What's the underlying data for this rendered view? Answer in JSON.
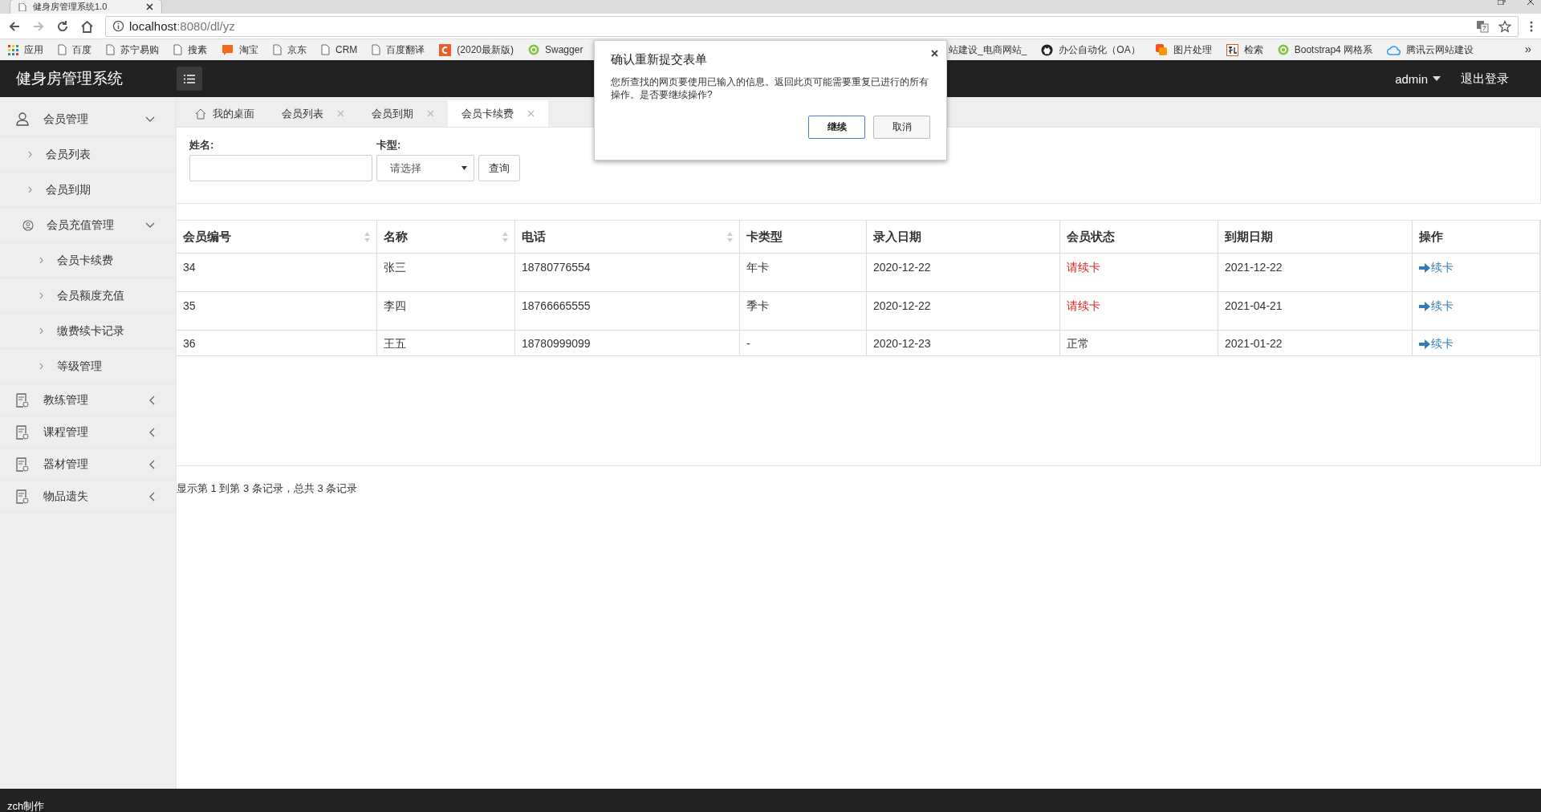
{
  "browser": {
    "tab_title": "健身房管理系统1.0",
    "url_host": "localhost",
    "url_rest": ":8080/dl/yz",
    "bookmarks_left": [
      {
        "label": "应用",
        "kind": "apps"
      },
      {
        "label": "百度",
        "kind": "page"
      },
      {
        "label": "苏宁易购",
        "kind": "page"
      },
      {
        "label": "搜素",
        "kind": "page"
      },
      {
        "label": "淘宝",
        "kind": "bubble"
      },
      {
        "label": "京东",
        "kind": "page"
      },
      {
        "label": "CRM",
        "kind": "page"
      },
      {
        "label": "百度翻译",
        "kind": "page"
      },
      {
        "label": "(2020最新版)",
        "kind": "square"
      },
      {
        "label": "Swagger",
        "kind": "ball"
      }
    ],
    "bookmarks_right": [
      {
        "label": "站建设_电商网站_",
        "kind": "none"
      },
      {
        "label": "办公自动化（OA）",
        "kind": "cat"
      },
      {
        "label": "图片处理",
        "kind": "squares"
      },
      {
        "label": "检索",
        "kind": "frame"
      },
      {
        "label": "Bootstrap4 网格系",
        "kind": "ball"
      },
      {
        "label": "腾讯云网站建设",
        "kind": "cloud"
      }
    ],
    "more": "»"
  },
  "header": {
    "title": "健身房管理系统",
    "user": "admin",
    "logout": "退出登录"
  },
  "sidebar": {
    "items": [
      {
        "label": "会员管理",
        "kind": "person",
        "expanded": true,
        "children": [
          {
            "label": "会员列表"
          },
          {
            "label": "会员到期"
          },
          {
            "label": "会员充值管理",
            "kind": "badge",
            "expanded": true,
            "children": [
              {
                "label": "会员卡续费"
              },
              {
                "label": "会员额度充值"
              },
              {
                "label": "缴费续卡记录"
              },
              {
                "label": "等级管理"
              }
            ]
          }
        ]
      },
      {
        "label": "教练管理",
        "kind": "form",
        "expanded": false
      },
      {
        "label": "课程管理",
        "kind": "form",
        "expanded": false
      },
      {
        "label": "器材管理",
        "kind": "form",
        "expanded": false
      },
      {
        "label": "物品遗失",
        "kind": "form",
        "expanded": false
      }
    ]
  },
  "tabs": [
    {
      "label": "我的桌面",
      "kind": "home",
      "closable": false,
      "selected": false
    },
    {
      "label": "会员列表",
      "closable": true,
      "selected": false
    },
    {
      "label": "会员到期",
      "closable": true,
      "selected": false
    },
    {
      "label": "会员卡续费",
      "closable": true,
      "selected": true
    }
  ],
  "filter": {
    "name_label": "姓名:",
    "card_label": "卡型:",
    "card_select": "请选择",
    "query_button": "查询"
  },
  "table": {
    "columns": [
      {
        "label": "会员编号",
        "sortable": true
      },
      {
        "label": "名称",
        "sortable": true
      },
      {
        "label": "电话",
        "sortable": true
      },
      {
        "label": "卡类型",
        "sortable": false
      },
      {
        "label": "录入日期",
        "sortable": false
      },
      {
        "label": "会员状态",
        "sortable": false
      },
      {
        "label": "到期日期",
        "sortable": false
      },
      {
        "label": "操作",
        "sortable": false
      }
    ],
    "rows": [
      {
        "cells": [
          "34",
          "张三",
          "18780776554",
          "年卡",
          "2020-12-22",
          "请续卡",
          "2021-12-22"
        ],
        "warning": true,
        "action": "续卡"
      },
      {
        "cells": [
          "35",
          "李四",
          "18766665555",
          "季卡",
          "2020-12-22",
          "请续卡",
          "2021-04-21"
        ],
        "warning": true,
        "action": "续卡"
      },
      {
        "cells": [
          "36",
          "王五",
          "18780999099",
          "-",
          "2020-12-23",
          "正常",
          "2021-01-22"
        ],
        "warning": false,
        "action": "续卡"
      }
    ]
  },
  "pagination": "显示第 1 到第 3 条记录，总共 3 条记录",
  "footer": "zch制作",
  "dialog": {
    "title": "确认重新提交表单",
    "message": "您所查找的网页要使用已输入的信息。返回此页可能需要重复已进行的所有操作。是否要继续操作?",
    "buttons": [
      {
        "label": "继续",
        "selected": true
      },
      {
        "label": "取消",
        "selected": false
      }
    ]
  }
}
